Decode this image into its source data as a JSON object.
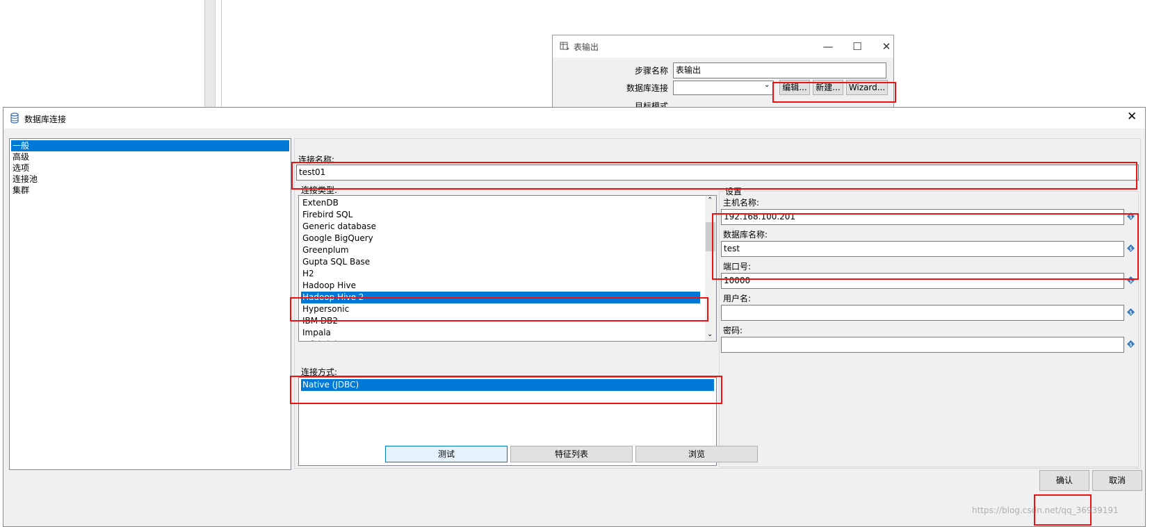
{
  "back_dialog": {
    "title": "表输出",
    "step_name_label": "步骤名称",
    "step_name_value": "表输出",
    "db_conn_label": "数据库连接",
    "db_conn_value": "",
    "edit_label": "编辑...",
    "new_label": "新建...",
    "wizard_label": "Wizard...",
    "target_schema_label": "目标模式"
  },
  "main_dialog": {
    "title": "数据库连接",
    "nav_items": [
      "一般",
      "高级",
      "选项",
      "连接池",
      "集群"
    ],
    "selected_nav": "一般",
    "connection_name_label": "连接名称:",
    "connection_name_value": "test01",
    "connection_type_label": "连接类型:",
    "connection_types": [
      "ExtenDB",
      "Firebird SQL",
      "Generic database",
      "Google BigQuery",
      "Greenplum",
      "Gupta SQL Base",
      "H2",
      "Hadoop Hive",
      "Hadoop Hive 2",
      "Hypersonic",
      "IBM DB2",
      "Impala",
      "Infobright"
    ],
    "selected_type": "Hadoop Hive 2",
    "access_label": "连接方式:",
    "access_methods": [
      "Native (JDBC)"
    ],
    "selected_access": "Native (JDBC)",
    "settings_label": "设置",
    "host_label": "主机名称:",
    "host_value": "192.168.100.201",
    "dbname_label": "数据库名称:",
    "dbname_value": "test",
    "port_label": "端口号:",
    "port_value": "10000",
    "user_label": "用户名:",
    "user_value": "",
    "password_label": "密码:",
    "password_value": "",
    "test_label": "测试",
    "features_label": "特征列表",
    "explore_label": "浏览",
    "ok_label": "确认",
    "cancel_label": "取消"
  },
  "watermark": "https://blog.csdn.net/qq_36939191",
  "colors": {
    "accent": "#0078d7",
    "highlight": "#ee1111"
  }
}
